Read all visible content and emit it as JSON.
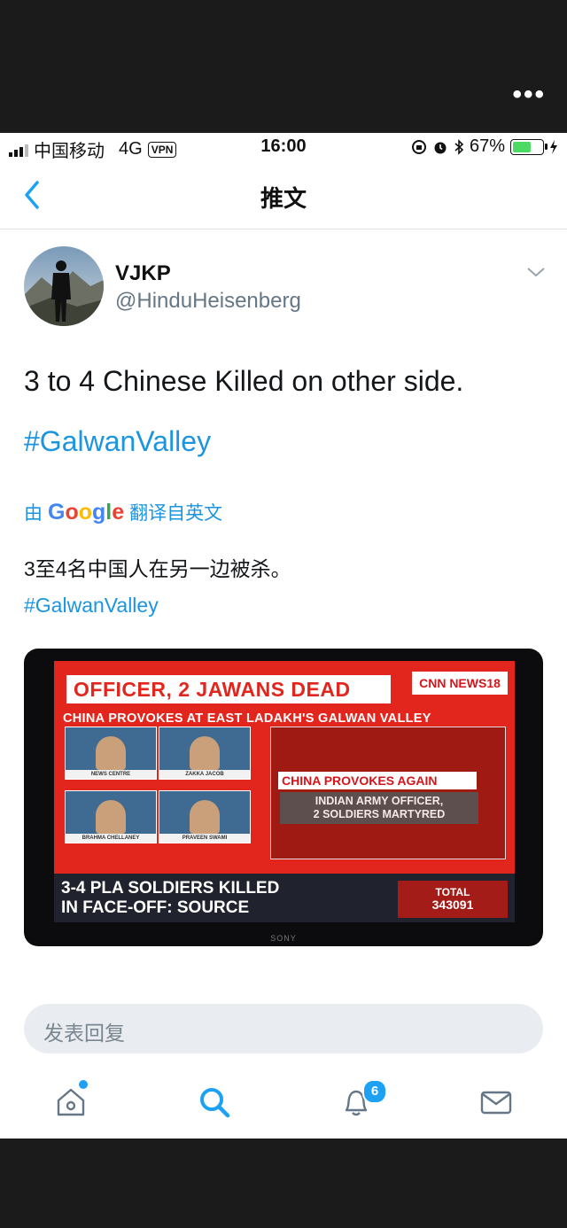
{
  "overlay": {
    "more_label": "•••"
  },
  "status_bar": {
    "carrier": "中国移动",
    "network": "4G",
    "vpn": "VPN",
    "time": "16:00",
    "battery": "67%",
    "battery_level": 0.67
  },
  "nav": {
    "title": "推文"
  },
  "tweet": {
    "name": "VJKP",
    "handle": "@HinduHeisenberg",
    "text": "3 to 4 Chinese Killed on other side.",
    "hashtag": "#GalwanValley",
    "translate_prefix": "由",
    "translate_logo": "Google",
    "translate_suffix": "翻译自英文",
    "translated_text": "3至4名中国人在另一边被杀。",
    "translated_hashtag": "#GalwanValley"
  },
  "media": {
    "headline": "OFFICER, 2 JAWANS DEAD",
    "channel": "CNN NEWS18",
    "subheadline": "CHINA PROVOKES AT EAST LADAKH'S GALWAN VALLEY",
    "panels": [
      "NEWS CENTRE",
      "ZAKKA JACOB",
      "BRAHMA CHELLANEY",
      "PRAVEEN SWAMI"
    ],
    "video_title": "CHINA PROVOKES AGAIN",
    "video_subtitle_1": "INDIAN ARMY OFFICER,",
    "video_subtitle_2": "2 SOLDIERS MARTYRED",
    "ticker_line1": "3-4 PLA SOLDIERS KILLED",
    "ticker_line2": "IN FACE-OFF: SOURCE",
    "total_label": "TOTAL",
    "total_value": "343091",
    "tv_brand": "SONY"
  },
  "reply": {
    "placeholder": "发表回复"
  },
  "tabs": {
    "notification_count": "6"
  },
  "colors": {
    "accent": "#1da1f2",
    "link": "#1b95e0",
    "battery": "#4cd964",
    "news_red": "#e2261d"
  }
}
